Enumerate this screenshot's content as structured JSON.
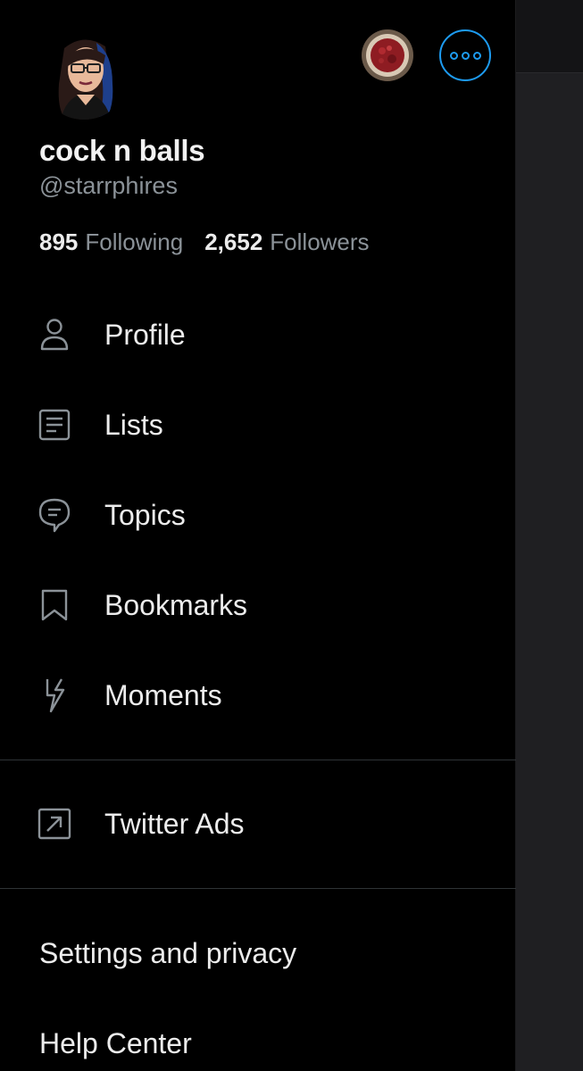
{
  "profile": {
    "display_name": "cock n balls",
    "handle": "@starrphires",
    "following_count": "895",
    "following_label": "Following",
    "followers_count": "2,652",
    "followers_label": "Followers"
  },
  "menu": [
    {
      "label": "Profile",
      "icon": "person-icon"
    },
    {
      "label": "Lists",
      "icon": "list-icon"
    },
    {
      "label": "Topics",
      "icon": "topics-icon"
    },
    {
      "label": "Bookmarks",
      "icon": "bookmark-icon"
    },
    {
      "label": "Moments",
      "icon": "lightning-icon"
    }
  ],
  "ads": {
    "label": "Twitter Ads",
    "icon": "external-link-icon"
  },
  "footer": {
    "settings_label": "Settings and privacy",
    "help_label": "Help Center"
  },
  "colors": {
    "accent": "#1d9bf0",
    "background": "#000000",
    "text_primary": "#ececec",
    "text_secondary": "#8b9298",
    "icon": "#8b9298"
  }
}
